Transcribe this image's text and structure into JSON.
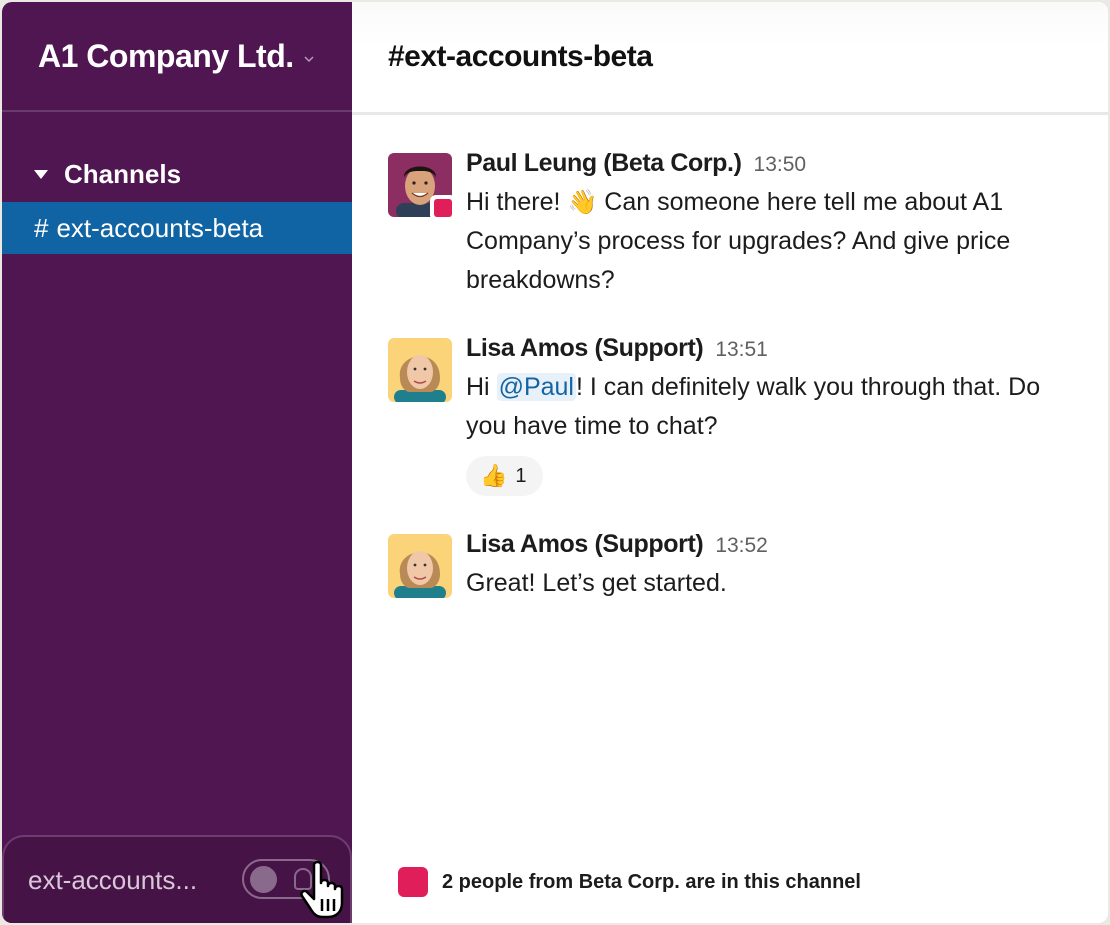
{
  "workspace": {
    "name": "A1 Company Ltd.",
    "menu_icon": "chevron-down-icon"
  },
  "sidebar": {
    "section_label": "Channels",
    "section_icon": "caret-down-icon",
    "channels": [
      {
        "hash": "#",
        "name": "ext-accounts-beta",
        "active": true
      }
    ],
    "footer": {
      "channel_preview": "ext-accounts...",
      "toggle_state": "off"
    }
  },
  "channel": {
    "title": "#ext-accounts-beta"
  },
  "messages": [
    {
      "author": "Paul Leung (Beta Corp.)",
      "time": "13:50",
      "external": true,
      "text_before": "Hi there! ",
      "emoji": "👋",
      "text_after": " Can someone here tell me about A1 Company’s process for upgrades? And give price breakdowns?"
    },
    {
      "author": "Lisa Amos (Support)",
      "time": "13:51",
      "external": false,
      "text_before": "Hi ",
      "mention": "@Paul",
      "text_after": "! I can definitely walk you through that. Do you have time to chat?",
      "reaction": {
        "emoji": "👍",
        "count": "1"
      }
    },
    {
      "author": "Lisa Amos (Support)",
      "time": "13:52",
      "external": false,
      "text": "Great! Let’s get started."
    }
  ],
  "notice": {
    "text": "2 people from Beta Corp. are in this channel",
    "color": "#e01e5a"
  },
  "colors": {
    "sidebar_bg": "#4f1652",
    "active_channel": "#1164a3",
    "external_accent": "#e01e5a",
    "mention": "#1264a3"
  }
}
